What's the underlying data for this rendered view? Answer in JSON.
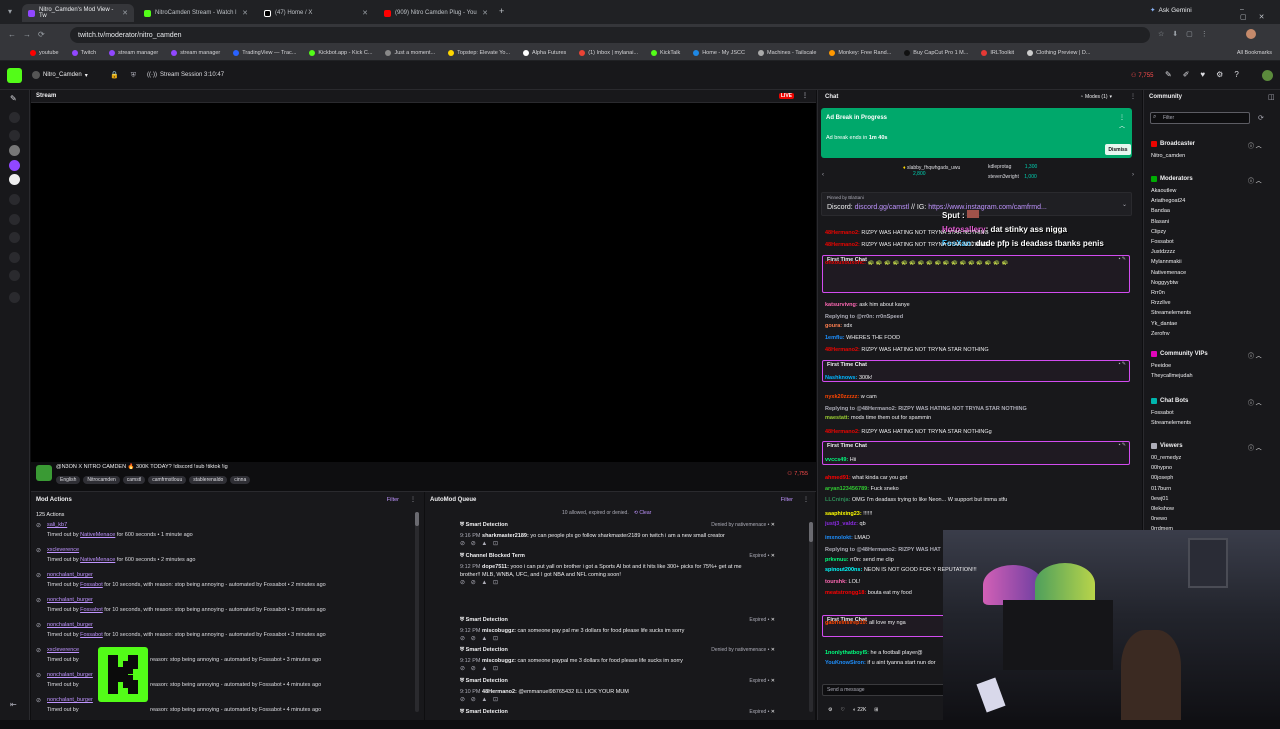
{
  "browser": {
    "tabs": [
      {
        "title": "Nitro_Camden's Mod View - Tw",
        "color": "#9147ff"
      },
      {
        "title": "NitroCamden Stream - Watch l",
        "color": "#53fc18"
      },
      {
        "title": "(47) Home / X",
        "color": "#ffffff"
      },
      {
        "title": "(909) Nitro Camden Plug - You",
        "color": "#ff0000"
      }
    ],
    "new_tab": "+",
    "ask_gemini": "Ask Gemini",
    "url": "twitch.tv/moderator/nitro_camden",
    "bookmarks": [
      "youtube",
      "Twitch",
      "stream manager",
      "stream manager",
      "TradingView — Trac...",
      "Kickbot.app - Kick C...",
      "Just a moment...",
      "Topstep: Elevate Yo...",
      "Alpha Futures",
      "(1) Inbox | mylanai...",
      "KickTalk",
      "Home - My JSCC",
      "Machines - Tailscale",
      "Monkey: Free Rand...",
      "Buy CapCut Pro 1 M...",
      "IRLToolkit",
      "Clothing Preview | D..."
    ],
    "all_bookmarks": "All Bookmarks"
  },
  "top": {
    "channel": "Nitro_Camden",
    "session": "Stream Session 3:10:47",
    "viewers": "7,755"
  },
  "stream": {
    "header": "Stream",
    "live": "LIVE",
    "title": "@N3ON X NITRO CAMDEN 🔥 300K TODAY? !discord !sub !tiktok !ig",
    "tags": [
      "English",
      "Nitrocamden",
      "camstl",
      "camfrmstlouu",
      "stablerenaldo",
      "cinna"
    ],
    "viewers": "7,755"
  },
  "modactions": {
    "header": "Mod Actions",
    "filter": "Filter",
    "count": "125 Actions",
    "items": [
      {
        "user": "sali_kb7",
        "text": "Timed out by",
        "mod": "NativeMenace",
        "rest": "for 600 seconds • 1 minute ago"
      },
      {
        "user": "xxcleverence",
        "text": "Timed out by",
        "mod": "NativeMenace",
        "rest": "for 600 seconds • 2 minutes ago"
      },
      {
        "user": "nonchalant_burger",
        "text": "Timed out by",
        "mod": "Fossabot",
        "rest": "for 10 seconds, with reason: stop being annoying - automated by Fossabot • 2 minutes ago"
      },
      {
        "user": "nonchalant_burger",
        "text": "Timed out by",
        "mod": "Fossabot",
        "rest": "for 10 seconds, with reason: stop being annoying - automated by Fossabot • 3 minutes ago"
      },
      {
        "user": "nonchalant_burger",
        "text": "Timed out by",
        "mod": "Fossabot",
        "rest": "for 10 seconds, with reason: stop being annoying - automated by Fossabot • 3 minutes ago"
      },
      {
        "user": "xxcleverence",
        "text": "Timed out by",
        "mod": "",
        "rest": "reason: stop being annoying - automated by Fossabot • 3 minutes ago"
      },
      {
        "user": "nonchalant_burger",
        "text": "Timed out by",
        "mod": "",
        "rest": "reason: stop being annoying - automated by Fossabot • 4 minutes ago"
      },
      {
        "user": "nonchalant_burger",
        "text": "Timed out by",
        "mod": "",
        "rest": "reason: stop being annoying - automated by Fossabot • 4 minutes ago"
      }
    ]
  },
  "automod": {
    "header": "AutoMod Queue",
    "filter": "Filter",
    "summary": "10 allowed, expired or denied.",
    "clear": "Clear",
    "items": [
      {
        "type": "Smart Detection",
        "status": "Denied by nativemenace •",
        "time": "9:16 PM",
        "user": "sharkmaster2189:",
        "msg": "yo can people pls go follow sharkmaster2189 on twitch i am a new small creator"
      },
      {
        "type": "Channel Blocked Term",
        "status": "Expired •",
        "time": "9:12 PM",
        "user": "dope7511:",
        "msg": "yooo i can put yall on brother i got a Sports AI bot and it hits like 300+ picks for 75%+ get at me brother!! MLB, WNBA, UFC, and I got NBA and NFL coming soon!"
      },
      {
        "type": "Smart Detection",
        "status": "Expired •",
        "time": "9:12 PM",
        "user": "miscobuggz:",
        "msg": "can someone pay pal me 3 dollars for food please life sucks im sorry"
      },
      {
        "type": "Smart Detection",
        "status": "Denied by nativemenace •",
        "time": "9:12 PM",
        "user": "miscobuggz:",
        "msg": "can someone paypal me 3 dollars for food please life sucks im sorry"
      },
      {
        "type": "Smart Detection",
        "status": "Expired •",
        "time": "9:10 PM",
        "user": "48Hermano2:",
        "msg": "@emmanuel98765432 ILL LICK YOUR MUM"
      },
      {
        "type": "Smart Detection",
        "status": "Expired •",
        "time": "",
        "user": "",
        "msg": ""
      }
    ]
  },
  "chat": {
    "header": "Chat",
    "modes": "Modes (1)",
    "ad_title": "Ad Break in Progress",
    "ad_sub": "Ad break ends in",
    "ad_time": "1m 40s",
    "dismiss": "Dismiss",
    "leaders": [
      {
        "name": "slabby_fhqwhgads_uwu",
        "pts": "2,800"
      },
      {
        "name": "kdleprotag",
        "pts": "1,300"
      },
      {
        "name": "steven3wright",
        "pts": "1,000"
      }
    ],
    "pinned_by": "Pinned by",
    "pinned_mod": "BlaSani",
    "pinned": "Discord:",
    "pinned_link": "discord.gg/camstl",
    "pinned_ig": "// IG:",
    "pinned_ig_link": "https://www.instagram.com/camfrmd...",
    "overlay": [
      {
        "user": "Sput :",
        "msg": ""
      },
      {
        "user": "Hotosallery",
        "msg": ": dat stinky ass nigga"
      },
      {
        "user": "FosXan",
        "msg": ": dude pfp is deadass tbanks penis"
      }
    ],
    "ftc": "First Time Chat",
    "input": "Send a message",
    "points": "22K",
    "chat_label": "Chat",
    "lines": [
      {
        "u": "48Hermano2:",
        "c": "#eb0400",
        "m": "RIZPY WAS HATING NOT TRYNA STAR NOTHING"
      },
      {
        "u": "48Hermano2:",
        "c": "#eb0400",
        "m": "RIZPY WAS HATING NOT TRYNA STAR NOTHING"
      },
      {
        "u": "ohxouxouxohc:",
        "c": "#eb0400",
        "m": "🐢 🐢 🐢 🐢 🐢 🐢 🐢 🐢 🐢 🐢 🐢 🐢 🐢 🐢 🐢 🐢 🐢"
      },
      {
        "u": "katsurvivng:",
        "c": "#ff69b4",
        "m": "ask him about kanye"
      },
      {
        "u": "Replying to @rr0n: rr0nSpeed",
        "c": "#adadb8",
        "m": ""
      },
      {
        "u": "goura:",
        "c": "#ff7f50",
        "m": "xdx"
      },
      {
        "u": "1emflu:",
        "c": "#1e90ff",
        "m": "WHERES THE FOOD"
      },
      {
        "u": "48Hermano2:",
        "c": "#eb0400",
        "m": "RIZPY WAS HATING NOT TRYNA STAR NOTHING"
      },
      {
        "u": "Nashknows:",
        "c": "#00b5ff",
        "m": "300k!"
      },
      {
        "u": "nyxk20zzzzz:",
        "c": "#ff4500",
        "m": "w cam"
      },
      {
        "u": "Replying to @48Hermano2: RIZPY WAS HATING NOT TRYNA STAR NOTHING",
        "c": "#adadb8",
        "m": ""
      },
      {
        "u": "maestatt:",
        "c": "#9acd32",
        "m": "mods time them out for spammin"
      },
      {
        "u": "48Hermano2:",
        "c": "#eb0400",
        "m": "RIZPY WAS HATING NOT TRYNA STAR NOTHINGg"
      },
      {
        "u": "vvccs49:",
        "c": "#00ff7f",
        "m": "Hii"
      },
      {
        "u": "ahmed91:",
        "c": "#ff0000",
        "m": "what kinda car you got"
      },
      {
        "u": "aryan123456789:",
        "c": "#32cd32",
        "m": "Fuck sneko"
      },
      {
        "u": "LLCninja:",
        "c": "#2e8b57",
        "m": "OMG I'm deadass trying to like Neon... W support but imma stfu"
      },
      {
        "u": "saaphixing23:",
        "c": "#ffff00",
        "m": "!!!!!!"
      },
      {
        "u": "justj3_valdz:",
        "c": "#8a2be2",
        "m": "qb"
      },
      {
        "u": "imxnolokt:",
        "c": "#1e90ff",
        "m": "LMAO"
      },
      {
        "u": "Replying to @48Hermano2: RIZPY WAS HAT",
        "c": "#adadb8",
        "m": ""
      },
      {
        "u": "prkvnuu:",
        "c": "#00ff7f",
        "m": "rr0n: send me clip"
      },
      {
        "u": "spinout200ns:",
        "c": "#00ffff",
        "m": "NEON IS NOT GOOD FOR Y REPUTATION!!!"
      },
      {
        "u": "tourshk:",
        "c": "#ff69b4",
        "m": "LOL!"
      },
      {
        "u": "meatstrongg18:",
        "c": "#ff0000",
        "m": "bouta eat my food"
      },
      {
        "u": "gabrielnsirep10:",
        "c": "#ff4500",
        "m": "all love my nga"
      },
      {
        "u": "1nonlythatboyl5:",
        "c": "#00ff7f",
        "m": "he a football player@"
      },
      {
        "u": "YouKnowSiron:",
        "c": "#1e90ff",
        "m": "if u aint tyanna start nun dor"
      }
    ]
  },
  "community": {
    "header": "Community",
    "filter": "Filter",
    "broadcaster": {
      "label": "Broadcaster",
      "names": [
        "Nitro_camden"
      ]
    },
    "moderators": {
      "label": "Moderators",
      "names": [
        "Akaoutlew",
        "Ariathegoat24",
        "Bandaa",
        "Blasani",
        "Clipzy",
        "Fossabot",
        "Justdzzzz",
        "Mylannmakii",
        "Nativemenace",
        "Noggyybtw",
        "Rrr0n",
        "Rrzzllve",
        "Streamelements",
        "Yk_dantae",
        "Zerofnv"
      ]
    },
    "vips": {
      "label": "Community VIPs",
      "names": [
        "Peeidoe",
        "Theycallmejudah"
      ]
    },
    "bots": {
      "label": "Chat Bots",
      "names": [
        "Fossabot",
        "Streamelements"
      ]
    },
    "viewers": {
      "label": "Viewers",
      "names": [
        "00_remedyz",
        "00hypno",
        "00joseph",
        "017burn",
        "0ewj01",
        "0lekshow",
        "0newo",
        "0rrdmem"
      ]
    }
  },
  "colors": {
    "twitch_purple": "#9147ff",
    "kick_green": "#53fc18",
    "live_red": "#eb0400",
    "ad_green": "#00a86b",
    "ftc_border": "#d24cf0",
    "link": "#bf94ff"
  }
}
